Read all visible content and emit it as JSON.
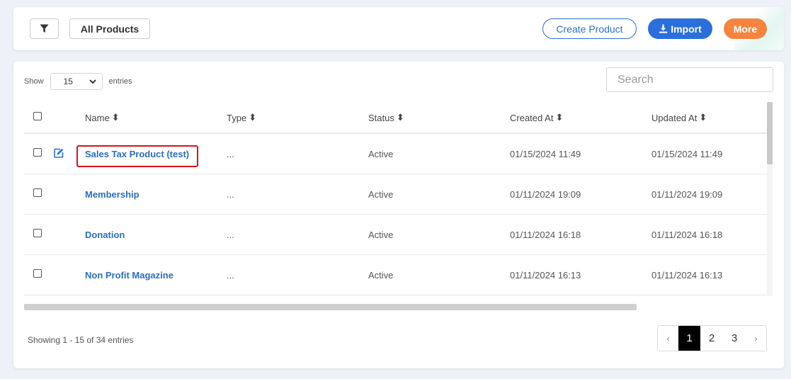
{
  "toolbar": {
    "filter_icon": "filter-icon",
    "view_label": "All Products",
    "create_label": "Create Product",
    "import_label": "Import",
    "more_label": "More",
    "colors": {
      "primary": "#2a6fdb",
      "more": "#f5843f"
    }
  },
  "table_controls": {
    "show_label": "Show",
    "entries_value": "15",
    "entries_label": "entries",
    "search_placeholder": "Search"
  },
  "table": {
    "columns": [
      "Name",
      "Type",
      "Status",
      "Created At",
      "Updated At"
    ],
    "rows": [
      {
        "name": "Sales Tax Product (test)",
        "type": "...",
        "status": "Active",
        "created": "01/15/2024 11:49",
        "updated": "01/15/2024 11:49"
      },
      {
        "name": "Membership",
        "type": "...",
        "status": "Active",
        "created": "01/11/2024 19:09",
        "updated": "01/11/2024 19:09"
      },
      {
        "name": "Donation",
        "type": "...",
        "status": "Active",
        "created": "01/11/2024 16:18",
        "updated": "01/11/2024 16:18"
      },
      {
        "name": "Non Profit Magazine",
        "type": "...",
        "status": "Active",
        "created": "01/11/2024 16:13",
        "updated": "01/11/2024 16:13"
      }
    ],
    "highlight_color": "#d6131b"
  },
  "footer": {
    "info": "Showing 1 - 15 of 34 entries",
    "pages": [
      "1",
      "2",
      "3"
    ],
    "prev": "‹",
    "next": "›"
  }
}
